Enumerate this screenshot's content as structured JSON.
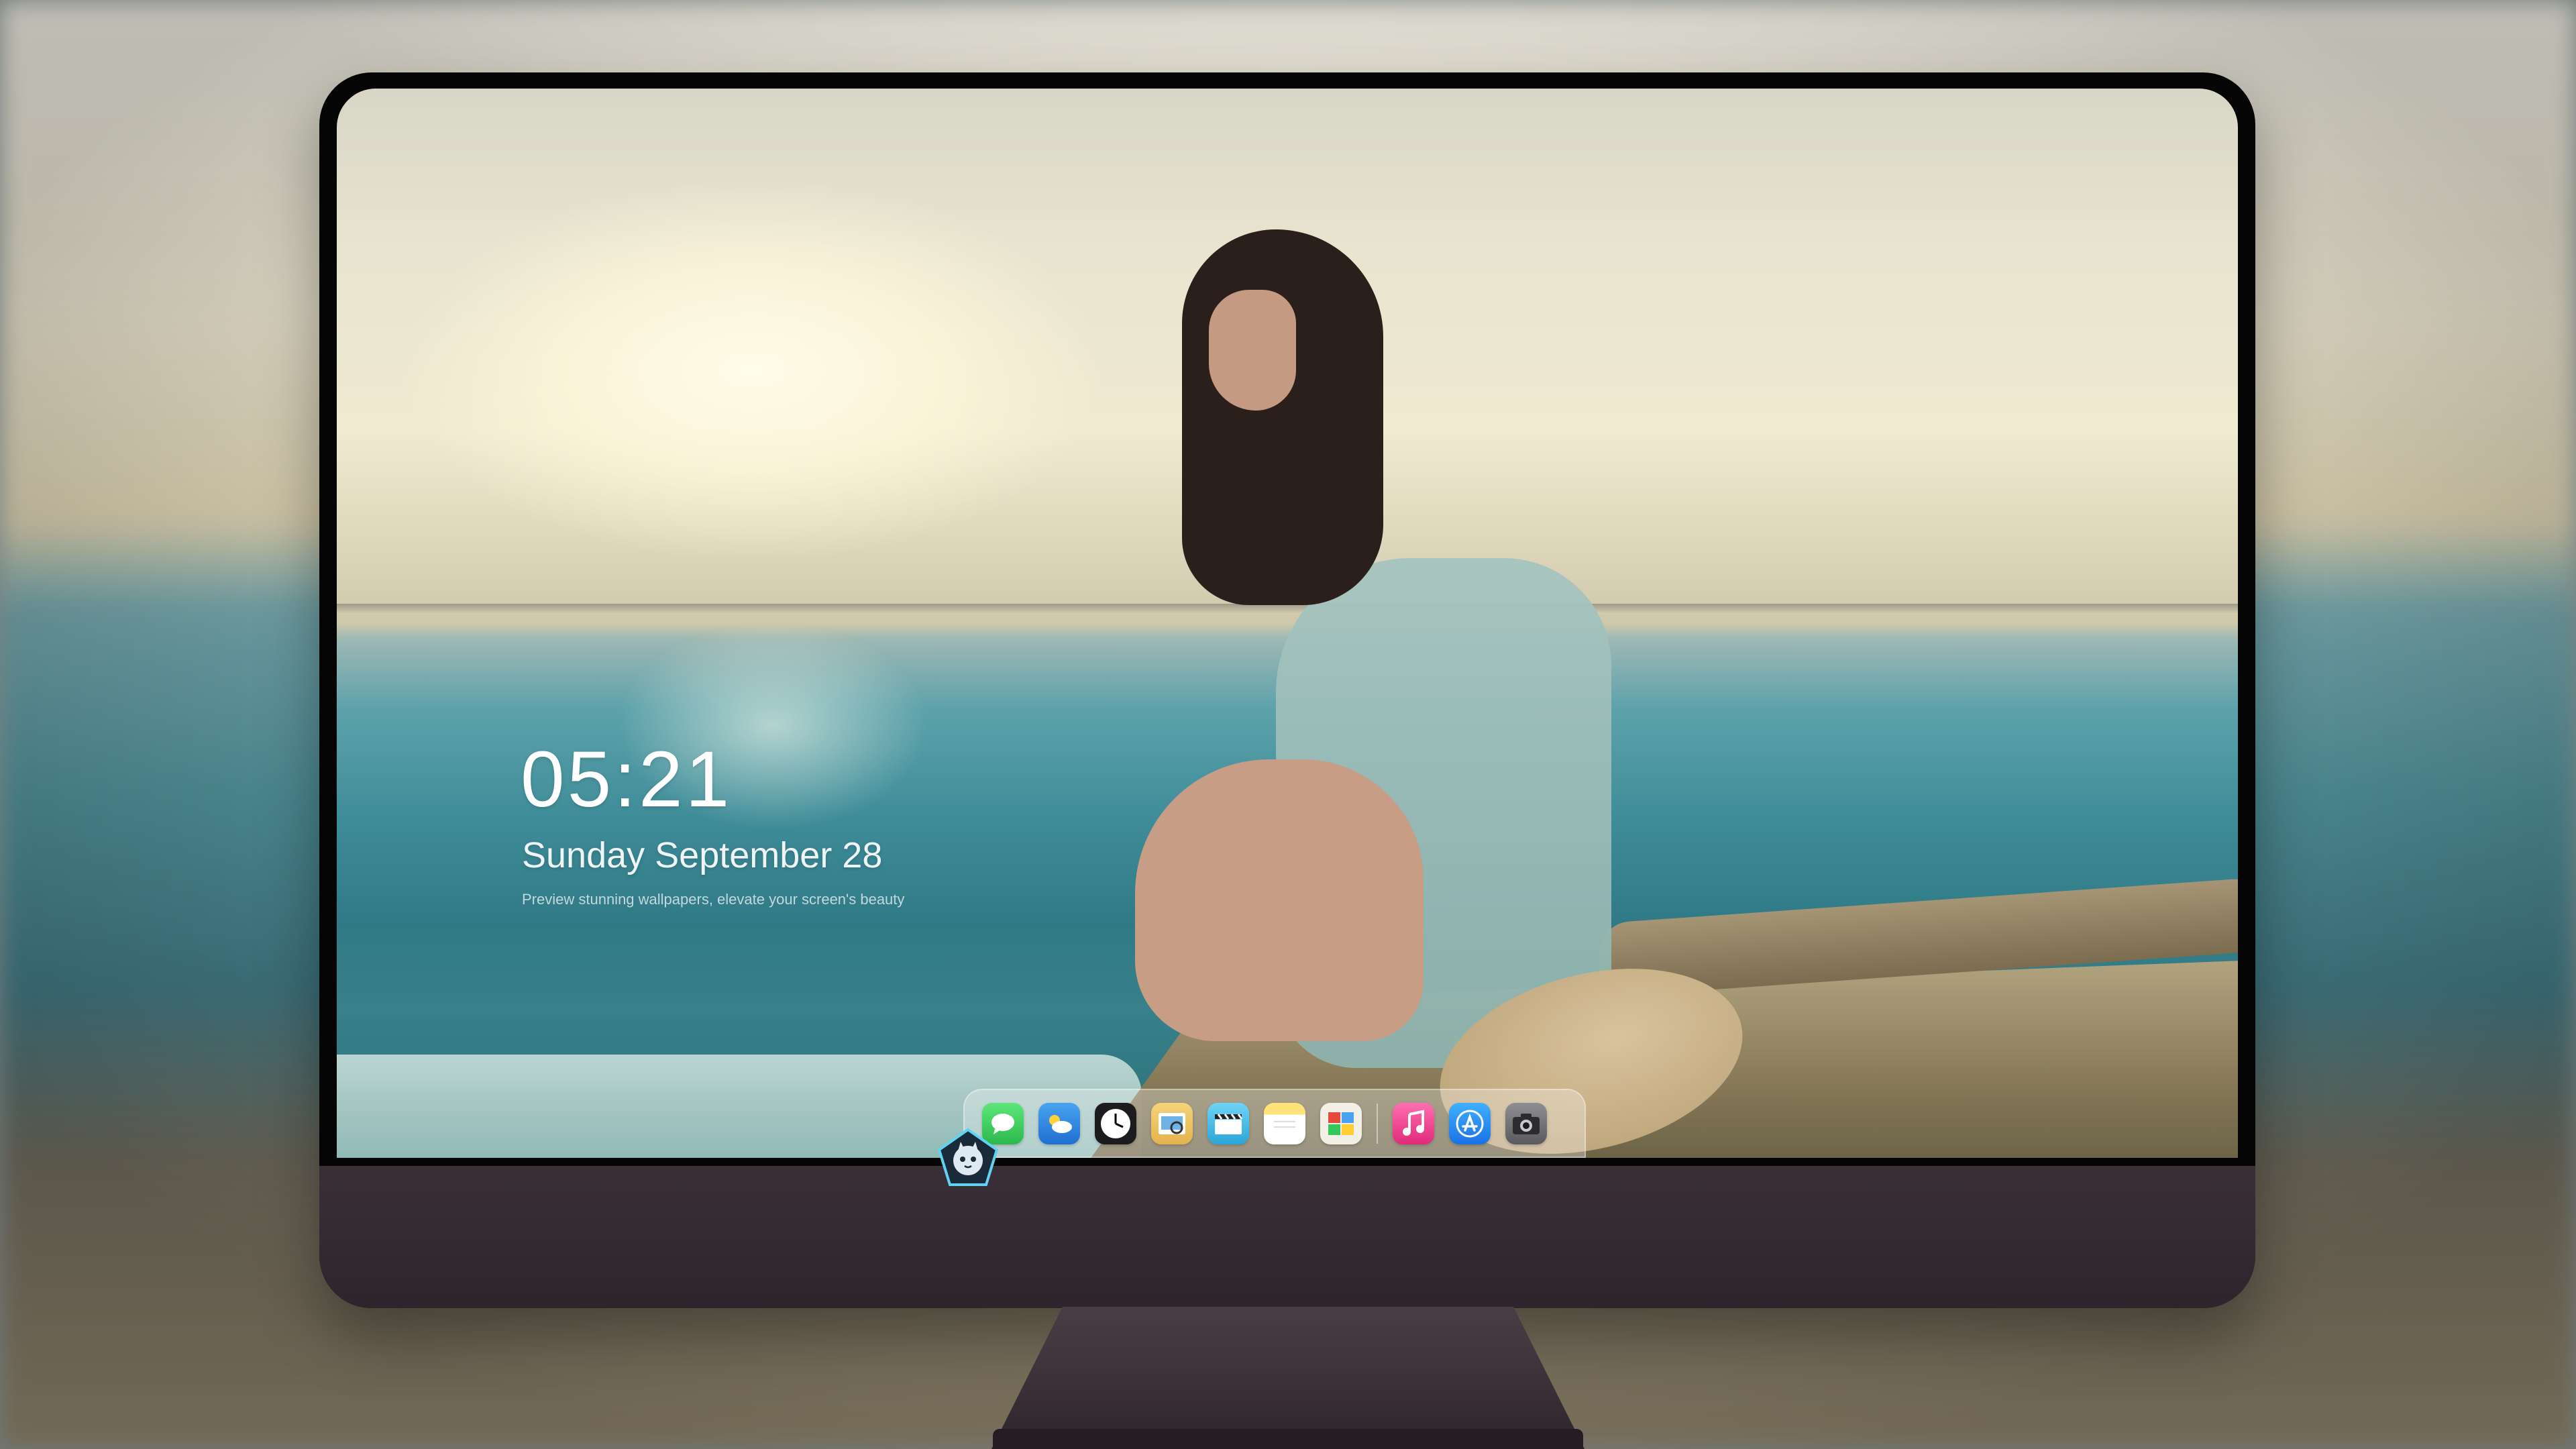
{
  "lockscreen": {
    "time": "05:21",
    "date": "Sunday September 28",
    "tagline": "Preview stunning wallpapers, elevate your screen's beauty"
  },
  "dock": {
    "apps": [
      {
        "name": "messages-icon",
        "glyph": "💬",
        "color": "#34c759"
      },
      {
        "name": "weather-icon",
        "glyph": "⛅",
        "color": "#3a8ee6"
      },
      {
        "name": "clock-icon",
        "glyph": "🕐",
        "color": "#ffffff"
      },
      {
        "name": "preview-icon",
        "glyph": "🖼",
        "color": "#6fb3e6"
      },
      {
        "name": "clips-icon",
        "glyph": "🎬",
        "color": "#4fc3e8"
      },
      {
        "name": "notes-icon",
        "glyph": "📝",
        "color": "#ffd54a"
      },
      {
        "name": "photo-booth-icon",
        "glyph": "🗂",
        "color": "#e8e0d0"
      },
      {
        "name": "music-icon",
        "glyph": "♫",
        "color": "#f23d8a"
      },
      {
        "name": "app-store-icon",
        "glyph": "A",
        "color": "#1e8ef7"
      },
      {
        "name": "camera-icon",
        "glyph": "📷",
        "color": "#5a5a5e"
      }
    ]
  }
}
